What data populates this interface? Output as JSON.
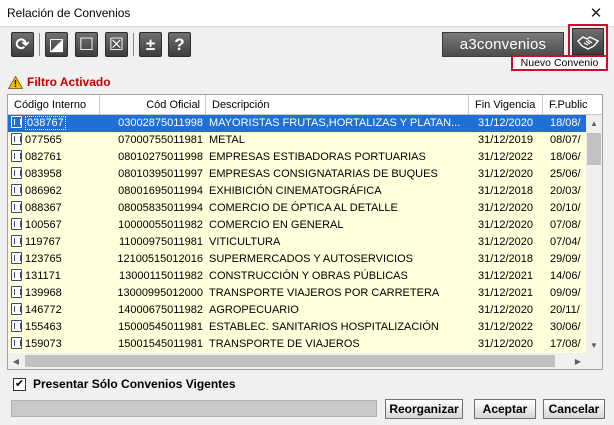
{
  "window": {
    "title": "Relación de Convenios",
    "close_glyph": "✕"
  },
  "toolbar": {
    "buttons": [
      {
        "name": "refresh-button",
        "icon": "refresh-icon",
        "glyph": "⟳"
      },
      {
        "name": "select-half-button",
        "icon": "half-square-icon",
        "glyph": "◪"
      },
      {
        "name": "select-none-button",
        "icon": "empty-square-icon",
        "glyph": "☐"
      },
      {
        "name": "deselect-button",
        "icon": "x-square-icon",
        "glyph": "☒"
      },
      {
        "name": "plus-minus-button",
        "icon": "plus-minus-icon",
        "glyph": "±"
      },
      {
        "name": "help-button",
        "icon": "question-icon",
        "glyph": "?"
      }
    ],
    "brand": "a3convenios",
    "nuevo_icon": "handshake-icon",
    "tooltip": "Nuevo Convenio"
  },
  "filter": {
    "label": "Filtro Activado",
    "icon": "warning-icon"
  },
  "table": {
    "headers": {
      "code": "Código Interno",
      "official": "Cód Oficial",
      "desc": "Descripción",
      "fin": "Fin Vigencia",
      "fp": "F.Public"
    },
    "rows": [
      {
        "code": "038767",
        "official": "03002875011998",
        "desc": "MAYORISTAS FRUTAS,HORTALIZAS Y PLATAN...",
        "fin": "31/12/2020",
        "fp": "18/08/",
        "selected": true
      },
      {
        "code": "077565",
        "official": "07000755011981",
        "desc": "METAL",
        "fin": "31/12/2019",
        "fp": "08/07/"
      },
      {
        "code": "082761",
        "official": "08010275011998",
        "desc": "EMPRESAS ESTIBADORAS PORTUARIAS",
        "fin": "31/12/2022",
        "fp": "18/06/"
      },
      {
        "code": "083958",
        "official": "08010395011997",
        "desc": "EMPRESAS CONSIGNATARIAS DE BUQUES",
        "fin": "31/12/2020",
        "fp": "25/06/"
      },
      {
        "code": "086962",
        "official": "08001695011994",
        "desc": "EXHIBICIÓN CINEMATOGRÁFICA",
        "fin": "31/12/2018",
        "fp": "20/03/"
      },
      {
        "code": "088367",
        "official": "08005835011994",
        "desc": "COMERCIO DE ÓPTICA AL DETALLE",
        "fin": "31/12/2020",
        "fp": "20/10/"
      },
      {
        "code": "100567",
        "official": "10000055011982",
        "desc": "COMERCIO EN GENERAL",
        "fin": "31/12/2020",
        "fp": "07/08/"
      },
      {
        "code": "119767",
        "official": "11000975011981",
        "desc": "VITICULTURA",
        "fin": "31/12/2020",
        "fp": "07/04/"
      },
      {
        "code": "123765",
        "official": "12100515012016",
        "desc": "SUPERMERCADOS Y AUTOSERVICIOS",
        "fin": "31/12/2018",
        "fp": "29/09/"
      },
      {
        "code": "131171",
        "official": "13000115011982",
        "desc": "CONSTRUCCIÓN Y OBRAS PÚBLICAS",
        "fin": "31/12/2021",
        "fp": "14/06/"
      },
      {
        "code": "139968",
        "official": "13000995012000",
        "desc": "TRANSPORTE VIAJEROS POR CARRETERA",
        "fin": "31/12/2021",
        "fp": "09/09/"
      },
      {
        "code": "146772",
        "official": "14000675011982",
        "desc": "AGROPECUARIO",
        "fin": "31/12/2020",
        "fp": "20/11/"
      },
      {
        "code": "155463",
        "official": "15000545011981",
        "desc": "ESTABLEC. SANITARIOS HOSPITALIZACIÓN",
        "fin": "31/12/2022",
        "fp": "30/06/"
      },
      {
        "code": "159073",
        "official": "15001545011981",
        "desc": "TRANSPORTE DE VIAJEROS",
        "fin": "31/12/2020",
        "fp": "17/08/"
      }
    ]
  },
  "options": {
    "only_vigentes_label": "Presentar Sólo Convenios Vigentes",
    "only_vigentes_checked": "✔"
  },
  "actions": {
    "reorganizar": "Reorganizar",
    "aceptar": "Aceptar",
    "cancelar": "Cancelar"
  }
}
